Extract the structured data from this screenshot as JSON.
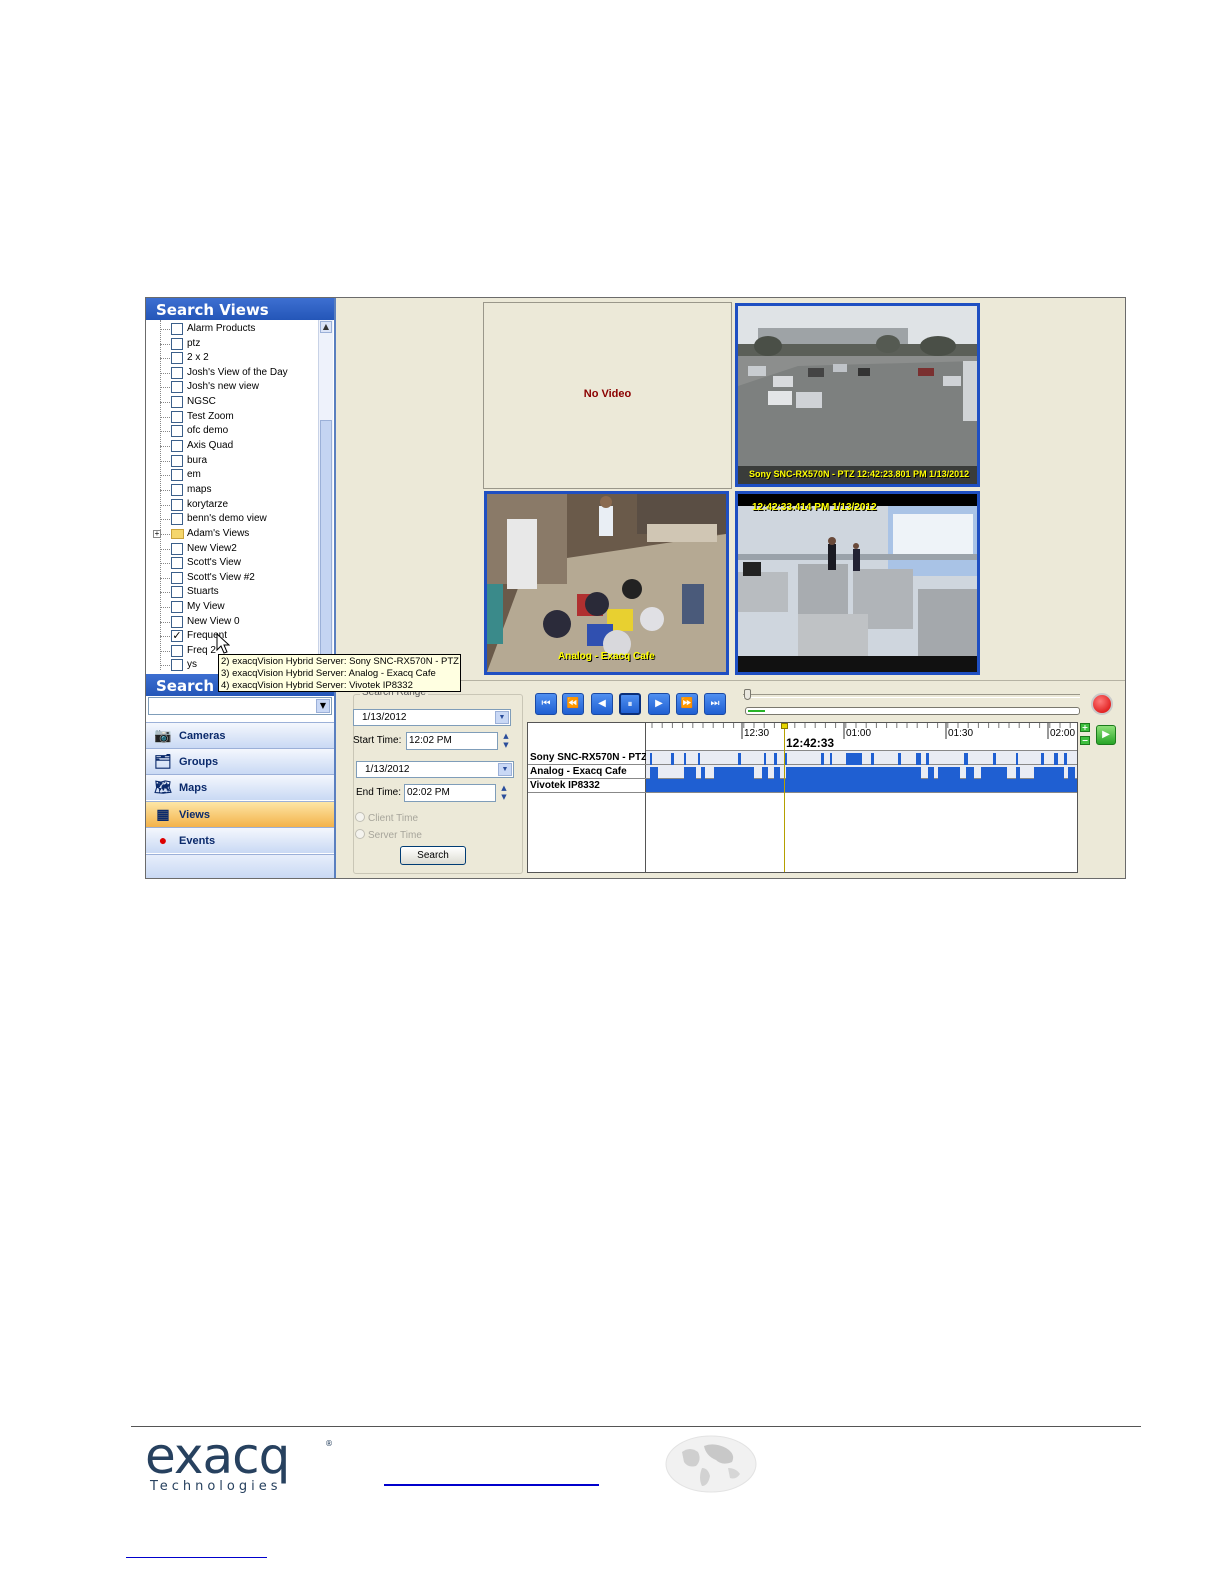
{
  "left_panel": {
    "title": "Search Views",
    "search_header": "Search",
    "views": [
      {
        "label": "Alarm Products",
        "checked": false
      },
      {
        "label": "ptz",
        "checked": false
      },
      {
        "label": "2 x 2",
        "checked": false
      },
      {
        "label": "Josh's View of the Day",
        "checked": false
      },
      {
        "label": "Josh's new view",
        "checked": false
      },
      {
        "label": "NGSC",
        "checked": false
      },
      {
        "label": "Test Zoom",
        "checked": false
      },
      {
        "label": "ofc demo",
        "checked": false
      },
      {
        "label": "Axis Quad",
        "checked": false
      },
      {
        "label": "bura",
        "checked": false
      },
      {
        "label": "em",
        "checked": false
      },
      {
        "label": "maps",
        "checked": false
      },
      {
        "label": "korytarze",
        "checked": false
      },
      {
        "label": "benn's demo view",
        "checked": false
      },
      {
        "label": "Adam's Views",
        "folder": true
      },
      {
        "label": "New View2",
        "checked": false
      },
      {
        "label": "Scott's View",
        "checked": false
      },
      {
        "label": "Scott's View #2",
        "checked": false
      },
      {
        "label": "Stuarts",
        "checked": false
      },
      {
        "label": "My View",
        "checked": false
      },
      {
        "label": "New View 0",
        "checked": false
      },
      {
        "label": "Frequent",
        "checked": true
      },
      {
        "label": "Freq 2",
        "checked": false
      },
      {
        "label": "ys",
        "checked": false
      }
    ],
    "nav": [
      {
        "label": "Cameras",
        "icon": "camera-icon"
      },
      {
        "label": "Groups",
        "icon": "groups-icon"
      },
      {
        "label": "Maps",
        "icon": "map-icon"
      },
      {
        "label": "Views",
        "icon": "views-icon",
        "active": true
      },
      {
        "label": "Events",
        "icon": "event-alarm-icon"
      }
    ]
  },
  "tooltip": {
    "lines": [
      "2) exacqVision Hybrid Server: Sony SNC-RX570N - PTZ",
      "3) exacqVision Hybrid Server: Analog - Exacq Cafe",
      "4) exacqVision Hybrid Server: Vivotek IP8332"
    ]
  },
  "video": {
    "no_video_label": "No Video",
    "cam1_overlay": "Sony SNC-RX570N - PTZ 12:42:23.801 PM 1/13/2012",
    "cam2_overlay": "Analog - Exacq Cafe",
    "cam3_overlay": "12:42:33.414 PM 1/13/2012"
  },
  "search_range": {
    "legend": "Search Range",
    "start_date": "1/13/2012",
    "start_time_label": "Start Time:",
    "start_time": "12:02 PM",
    "end_date": "1/13/2012",
    "end_time_label": "End Time:",
    "end_time": "02:02 PM",
    "client_time": "Client Time",
    "server_time": "Server Time",
    "search_button": "Search"
  },
  "playback": {
    "buttons": [
      "skip-start",
      "rewind",
      "step-back",
      "pause",
      "step-forward",
      "fast-forward",
      "skip-end"
    ],
    "progress_fraction": 0.05
  },
  "timeline": {
    "current_time": "12:42:33",
    "ticks": [
      "12:30",
      "01:00",
      "01:30",
      "02:00"
    ],
    "tracks": [
      "Sony SNC-RX570N - PTZ",
      "Analog - Exacq Cafe",
      "Vivotek IP8332"
    ]
  },
  "footer": {
    "logo_word": "exacq",
    "logo_reg": "®",
    "logo_sub": "Technologies"
  },
  "colors": {
    "panel_header": "#2456b8",
    "active_nav": "#f3b24a",
    "camera_border": "#1f4fc2",
    "overlay_text": "#ffff00",
    "timeline_recording": "#1f5fd2",
    "playhead": "#e7d700"
  }
}
